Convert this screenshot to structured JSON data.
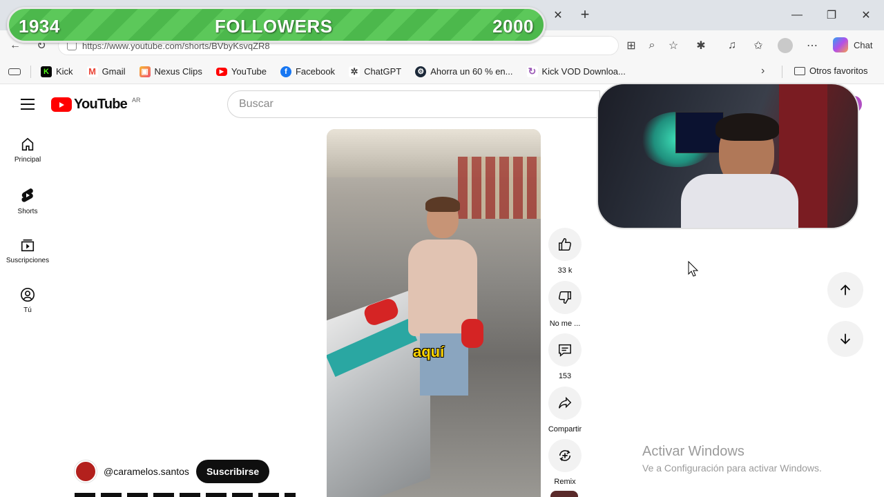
{
  "overlay": {
    "current": "1934",
    "title": "FOLLOWERS",
    "goal": "2000",
    "progress": 0.967
  },
  "browser": {
    "url": "https://www.youtube.com/shorts/BVbyKsvqZR8",
    "chat_label": "Chat",
    "bookmarks": [
      {
        "label": "Kick",
        "icon": "kick-icon",
        "color": "#53fc18"
      },
      {
        "label": "Gmail",
        "icon": "gmail-icon",
        "color": "#ea4335"
      },
      {
        "label": "Nexus Clips",
        "icon": "nexus-clips-icon",
        "color": "#f0506e"
      },
      {
        "label": "YouTube",
        "icon": "youtube-icon",
        "color": "#ff0000"
      },
      {
        "label": "Facebook",
        "icon": "facebook-icon",
        "color": "#1877f2"
      },
      {
        "label": "ChatGPT",
        "icon": "chatgpt-icon",
        "color": "#444444"
      },
      {
        "label": "Ahorra un 60 % en...",
        "icon": "steam-icon",
        "color": "#1b2838"
      },
      {
        "label": "Kick VOD Downloa...",
        "icon": "kick-vod-icon",
        "color": "#9b59b6"
      }
    ],
    "other_favorites": "Otros favoritos"
  },
  "youtube": {
    "logo_text": "YouTube",
    "country": "AR",
    "search_placeholder": "Buscar",
    "nav": [
      {
        "label": "Principal",
        "icon": "home-icon"
      },
      {
        "label": "Shorts",
        "icon": "shorts-icon"
      },
      {
        "label": "Suscripciones",
        "icon": "subscriptions-icon"
      },
      {
        "label": "Tú",
        "icon": "you-icon"
      }
    ],
    "caption": "aquí",
    "actions": [
      {
        "label": "33 k",
        "icon": "thumbs-up-icon"
      },
      {
        "label": "No me ...",
        "icon": "thumbs-down-icon"
      },
      {
        "label": "153",
        "icon": "comments-icon"
      },
      {
        "label": "Compartir",
        "icon": "share-icon"
      },
      {
        "label": "Remix",
        "icon": "remix-icon"
      }
    ],
    "channel": "@caramelos.santos",
    "subscribe_label": "Suscribirse"
  },
  "windows_watermark": {
    "line1": "Activar Windows",
    "line2": "Ve a Configuración para activar Windows."
  }
}
